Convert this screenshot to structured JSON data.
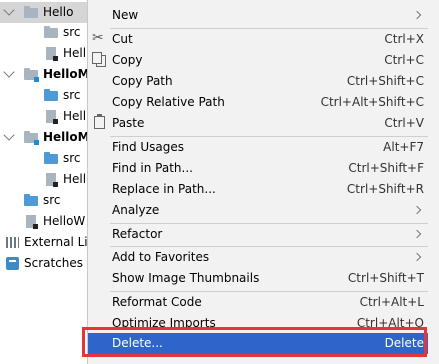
{
  "tree": {
    "rows": [
      {
        "label": "Hello",
        "bold": false
      },
      {
        "label": "src",
        "bold": false
      },
      {
        "label": "Hell",
        "bold": false
      },
      {
        "label": "HelloM",
        "bold": true
      },
      {
        "label": "src",
        "bold": false
      },
      {
        "label": "Hell",
        "bold": false
      },
      {
        "label": "HelloM",
        "bold": true
      },
      {
        "label": "src",
        "bold": false
      },
      {
        "label": "Hell",
        "bold": false
      },
      {
        "label": "src",
        "bold": false
      },
      {
        "label": "HelloW",
        "bold": false
      },
      {
        "label": "External Lib",
        "bold": false
      },
      {
        "label": "Scratches a",
        "bold": false
      }
    ]
  },
  "menu": {
    "items": [
      {
        "label": "New",
        "shortcut": ""
      },
      {
        "label": "Cut",
        "shortcut": "Ctrl+X"
      },
      {
        "label": "Copy",
        "shortcut": "Ctrl+C"
      },
      {
        "label": "Copy Path",
        "shortcut": "Ctrl+Shift+C"
      },
      {
        "label": "Copy Relative Path",
        "shortcut": "Ctrl+Alt+Shift+C"
      },
      {
        "label": "Paste",
        "shortcut": "Ctrl+V"
      },
      {
        "label": "Find Usages",
        "shortcut": "Alt+F7"
      },
      {
        "label": "Find in Path...",
        "shortcut": "Ctrl+Shift+F"
      },
      {
        "label": "Replace in Path...",
        "shortcut": "Ctrl+Shift+R"
      },
      {
        "label": "Analyze",
        "shortcut": ""
      },
      {
        "label": "Refactor",
        "shortcut": ""
      },
      {
        "label": "Add to Favorites",
        "shortcut": ""
      },
      {
        "label": "Show Image Thumbnails",
        "shortcut": "Ctrl+Shift+T"
      },
      {
        "label": "Reformat Code",
        "shortcut": "Ctrl+Alt+L"
      },
      {
        "label": "Optimize Imports",
        "shortcut": "Ctrl+Alt+O"
      },
      {
        "label": "Delete...",
        "shortcut": "Delete"
      }
    ]
  },
  "colors": {
    "highlight": "#2f65ca",
    "callout": "#e8333a",
    "menu_bg": "#f2f2f2"
  }
}
